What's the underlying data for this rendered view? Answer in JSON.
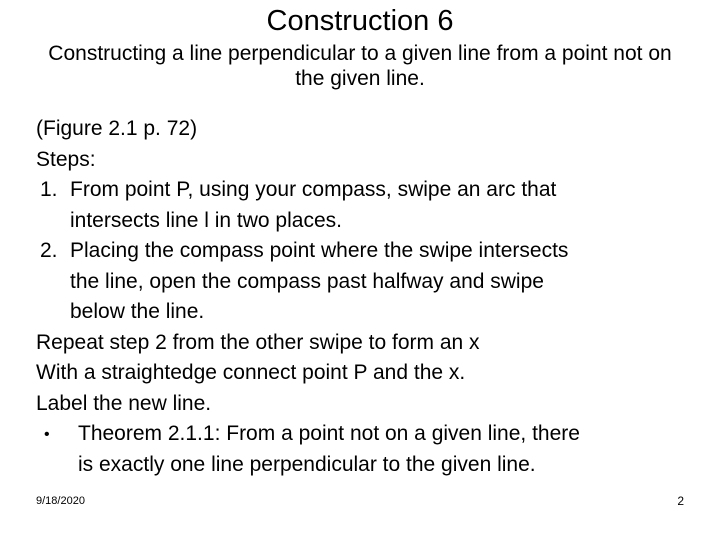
{
  "slide": {
    "title": "Construction 6",
    "subtitle": "Constructing a line perpendicular to a given line from a point not on the given line.",
    "figure_reference": "(Figure 2.1 p. 72)",
    "steps_label": "Steps:",
    "steps": [
      {
        "marker": "1.",
        "line1": "From point P, using your compass, swipe an arc that",
        "line2": "intersects line l in two places."
      },
      {
        "marker": "2.",
        "line1": "Placing the compass point where the swipe intersects",
        "line2": "the line, open the compass past halfway and swipe",
        "line3": "below the line."
      }
    ],
    "closing_lines": [
      "Repeat step 2 from the other swipe to form an x",
      "With a straightedge connect point P and the x.",
      "Label the new line."
    ],
    "theorem": {
      "marker": "•",
      "line1": "Theorem 2.1.1:  From a point not on a given line, there",
      "line2": "is exactly one line perpendicular to the given line."
    }
  },
  "footer": {
    "date": "9/18/2020",
    "page_number": "2"
  },
  "colors": {
    "background": "#ffffff",
    "text": "#000000"
  }
}
